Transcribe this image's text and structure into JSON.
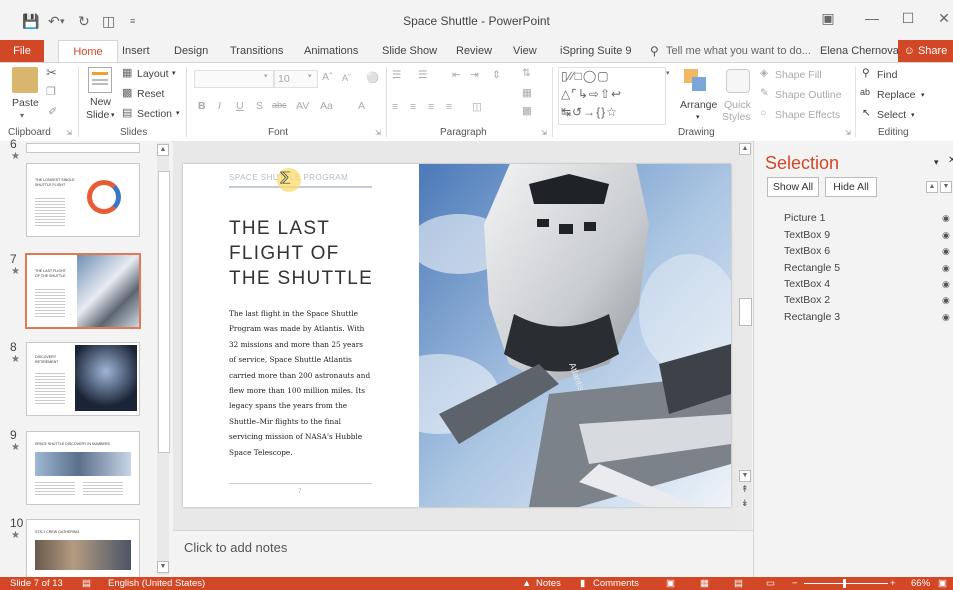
{
  "window": {
    "title": "Space Shuttle - PowerPoint"
  },
  "ribbon_tabs": [
    "File",
    "Home",
    "Insert",
    "Design",
    "Transitions",
    "Animations",
    "Slide Show",
    "Review",
    "View",
    "iSpring Suite 9"
  ],
  "tell_me": "Tell me what you want to do...",
  "user": "Elena Chernova",
  "share": "Share",
  "clipboard": {
    "paste": "Paste",
    "label": "Clipboard"
  },
  "slides_group": {
    "new_slide_1": "New",
    "new_slide_2": "Slide",
    "layout": "Layout",
    "reset": "Reset",
    "section": "Section",
    "label": "Slides"
  },
  "font_group": {
    "font_size": "10",
    "label": "Font"
  },
  "paragraph_group": {
    "label": "Paragraph"
  },
  "drawing_group": {
    "arrange": "Arrange",
    "quick_styles_1": "Quick",
    "quick_styles_2": "Styles",
    "shape_fill": "Shape Fill",
    "shape_outline": "Shape Outline",
    "shape_effects": "Shape Effects",
    "label": "Drawing"
  },
  "editing_group": {
    "find": "Find",
    "replace": "Replace",
    "select": "Select",
    "label": "Editing"
  },
  "thumbnails": [
    {
      "num": "6",
      "title": "THE LONGEST SINGLE SHUTTLE FLIGHT"
    },
    {
      "num": "7",
      "title": "THE LAST FLIGHT OF THE SHUTTLE"
    },
    {
      "num": "8",
      "title": "DISCOVERY RETIREMENT"
    },
    {
      "num": "9",
      "title": "SPACE SHUTTLE DISCOVERY IN NUMBERS"
    },
    {
      "num": "10",
      "title": "STS-1 CREW GATHERING"
    }
  ],
  "slide": {
    "program": "SPACE SHUTTLE PROGRAM",
    "title_1": "THE LAST",
    "title_2": "FLIGHT OF",
    "title_3": "THE SHUTTLE",
    "body": [
      "The last flight in the Space Shuttle",
      "Program was made by Atlantis. With",
      "32 missions and more than 25 years",
      "of service, Space Shuttle Atlantis",
      "carried more than 200 astronauts and",
      "flew more than 100 million miles. Its",
      "legacy spans the years from the",
      "Shuttle–Mir flights to the final",
      "servicing mission of NASA's Hubble",
      "Space Telescope."
    ],
    "page": "7",
    "shuttle_label": "Atlantis"
  },
  "notes_placeholder": "Click to add notes",
  "selection_pane": {
    "title": "Selection",
    "show_all": "Show All",
    "hide_all": "Hide All",
    "objects": [
      "Picture 1",
      "TextBox 9",
      "TextBox 6",
      "Rectangle 5",
      "TextBox 4",
      "TextBox 2",
      "Rectangle 3"
    ]
  },
  "status": {
    "slide": "Slide 7 of 13",
    "language": "English (United States)",
    "notes": "Notes",
    "comments": "Comments",
    "zoom": "66%"
  },
  "colors": {
    "accent": "#d24726",
    "thumb_selected": "#e07a54"
  }
}
